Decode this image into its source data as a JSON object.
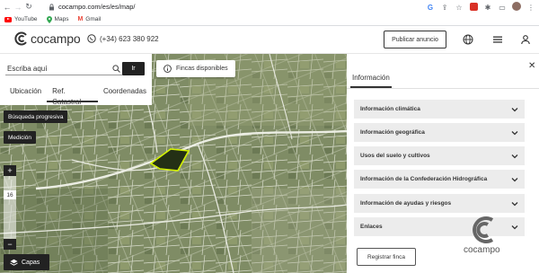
{
  "browser": {
    "url": "cocampo.com/es/es/map/",
    "bookmarks": [
      {
        "label": "YouTube",
        "icon": "youtube-icon"
      },
      {
        "label": "Maps",
        "icon": "maps-pin-icon"
      },
      {
        "label": "Gmail",
        "icon": "gmail-icon"
      }
    ]
  },
  "header": {
    "logo_text": "cocampo",
    "phone": "(+34) 623 380 922",
    "publish_label": "Publicar anuncio"
  },
  "search": {
    "placeholder": "Escriba aquí",
    "go_label": "Ir",
    "tabs": [
      {
        "label": "Ubicación",
        "active": false
      },
      {
        "label": "Ref. Catastral",
        "active": true
      },
      {
        "label": "Coordenadas",
        "active": false
      }
    ]
  },
  "map": {
    "fincas_label": "Fincas disponibles",
    "busqueda_label": "Búsqueda progresiva",
    "medicion_label": "Medición",
    "zoom_in": "+",
    "zoom_level": "16",
    "zoom_out": "−",
    "capas_label": "Capas"
  },
  "info": {
    "tab_label": "Información",
    "sections": [
      {
        "label": "Información climática"
      },
      {
        "label": "Información geográfica"
      },
      {
        "label": "Usos del suelo y cultivos"
      },
      {
        "label": "Información de la Confederación Hidrográfica"
      },
      {
        "label": "Información de ayudas y riesgos"
      },
      {
        "label": "Enlaces"
      }
    ],
    "register_label": "Registrar finca",
    "watermark_text": "cocampo"
  },
  "colors": {
    "brand_dark": "#222222",
    "map_base": "#7c8a63",
    "highlight": "#d4f200",
    "accordion_bg": "#ececec"
  }
}
